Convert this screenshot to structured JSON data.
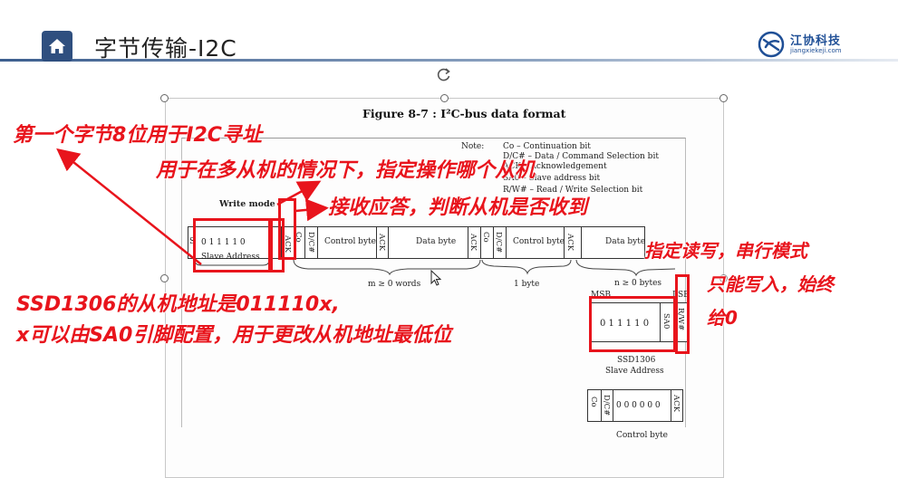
{
  "header": {
    "title": "字节传输-I2C",
    "logo_name": "江协科技",
    "logo_url": "jiangxiekeji.com"
  },
  "figure": {
    "title": "Figure 8-7 : I²C-bus data format",
    "note_label": "Note:",
    "notes": [
      "Co – Continuation bit",
      "D/C# – Data / Command Selection bit",
      "ACK – Acknowledgement",
      "SA0 – Slave address bit",
      "R/W# – Read / Write Selection bit"
    ],
    "write_mode": "Write mode",
    "frame": {
      "s": "S",
      "address_bits": "0 1 1 1 1 0",
      "ack": "ACK",
      "co": "Co",
      "dc": "D/C#",
      "control_byte": "Control byte",
      "data_byte": "Data byte",
      "slave_address": "Slave Address",
      "m_words": "m ≥ 0 words",
      "one_byte": "1 byte",
      "n_bytes": "n ≥ 0 bytes",
      "msb": "MSB",
      "lsb": "LSB",
      "detail_bits": "0 1 1 1 1 0",
      "sa0": "SA0",
      "rw": "R/W#",
      "chip": "SSD1306",
      "chip_addr": "Slave Address",
      "control_bits": "0 0 0 0 0 0",
      "control_label": "Control byte"
    }
  },
  "annotations": {
    "first_byte": "第一个字节8位用于I2C寻址",
    "multi_slave": "用于在多从机的情况下，指定操作哪个从机",
    "ack": "接收应答，判断从机是否收到",
    "rw": "指定读写，串行模式",
    "rw_line2": "只能写入，始终",
    "rw_line3": "给0",
    "addr_line1": "SSD1306的从机地址是011110x,",
    "addr_line2": "x可以由SA0引脚配置，用于更改从机地址最低位"
  },
  "colors": {
    "accent": "#2f4f7f",
    "annotation": "#e8141c"
  },
  "icons": [
    "home-icon",
    "rotate-icon",
    "move-cursor-icon",
    "logo-mark-icon"
  ]
}
